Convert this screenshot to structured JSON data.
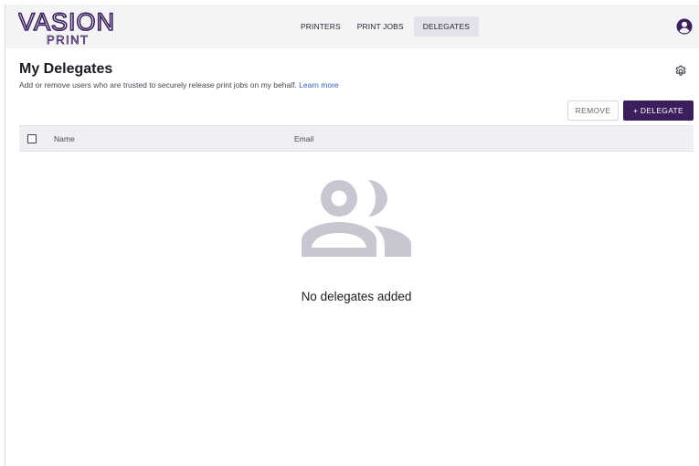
{
  "app": {
    "logo_primary": "VASION",
    "logo_secondary": "PRINT"
  },
  "nav": {
    "items": [
      {
        "label": "PRINTERS",
        "active": false
      },
      {
        "label": "PRINT JOBS",
        "active": false
      },
      {
        "label": "DELEGATES",
        "active": true
      }
    ]
  },
  "header": {
    "title": "My Delegates",
    "subtitle": "Add or remove users who are trusted to securely release print jobs on my behalf.",
    "learn_more": "Learn more"
  },
  "toolbar": {
    "remove_label": "REMOVE",
    "add_label": "+  DELEGATE"
  },
  "table": {
    "columns": [
      "Name",
      "Email"
    ],
    "rows": []
  },
  "empty_state": {
    "message": "No delegates added"
  },
  "icons": {
    "account": "account-circle-icon",
    "settings": "gear-icon",
    "empty": "people-icon"
  },
  "colors": {
    "brand": "#3a1f5c",
    "topbar_bg": "#f4f4f7",
    "link": "#3461b8",
    "empty_icon": "#c9c6d1"
  }
}
